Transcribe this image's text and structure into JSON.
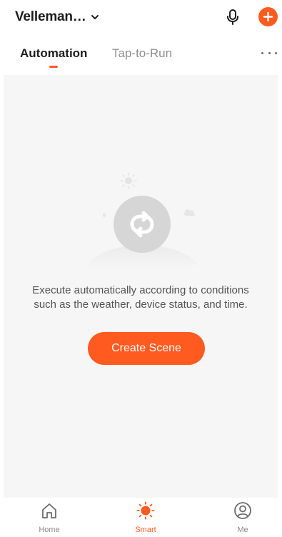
{
  "header": {
    "home_name": "Velleman…"
  },
  "tabs": [
    {
      "label": "Automation",
      "active": true
    },
    {
      "label": "Tap-to-Run",
      "active": false
    }
  ],
  "empty_state": {
    "line1": "Execute automatically according to conditions",
    "line2": "such as the weather, device status, and time.",
    "button_label": "Create Scene"
  },
  "bottom_nav": [
    {
      "label": "Home",
      "icon": "home-icon",
      "active": false
    },
    {
      "label": "Smart",
      "icon": "sun-icon",
      "active": true
    },
    {
      "label": "Me",
      "icon": "user-icon",
      "active": false
    }
  ],
  "colors": {
    "accent": "#ff5a1f",
    "background": "#f6f6f6",
    "muted_text": "#8e8e8e"
  }
}
